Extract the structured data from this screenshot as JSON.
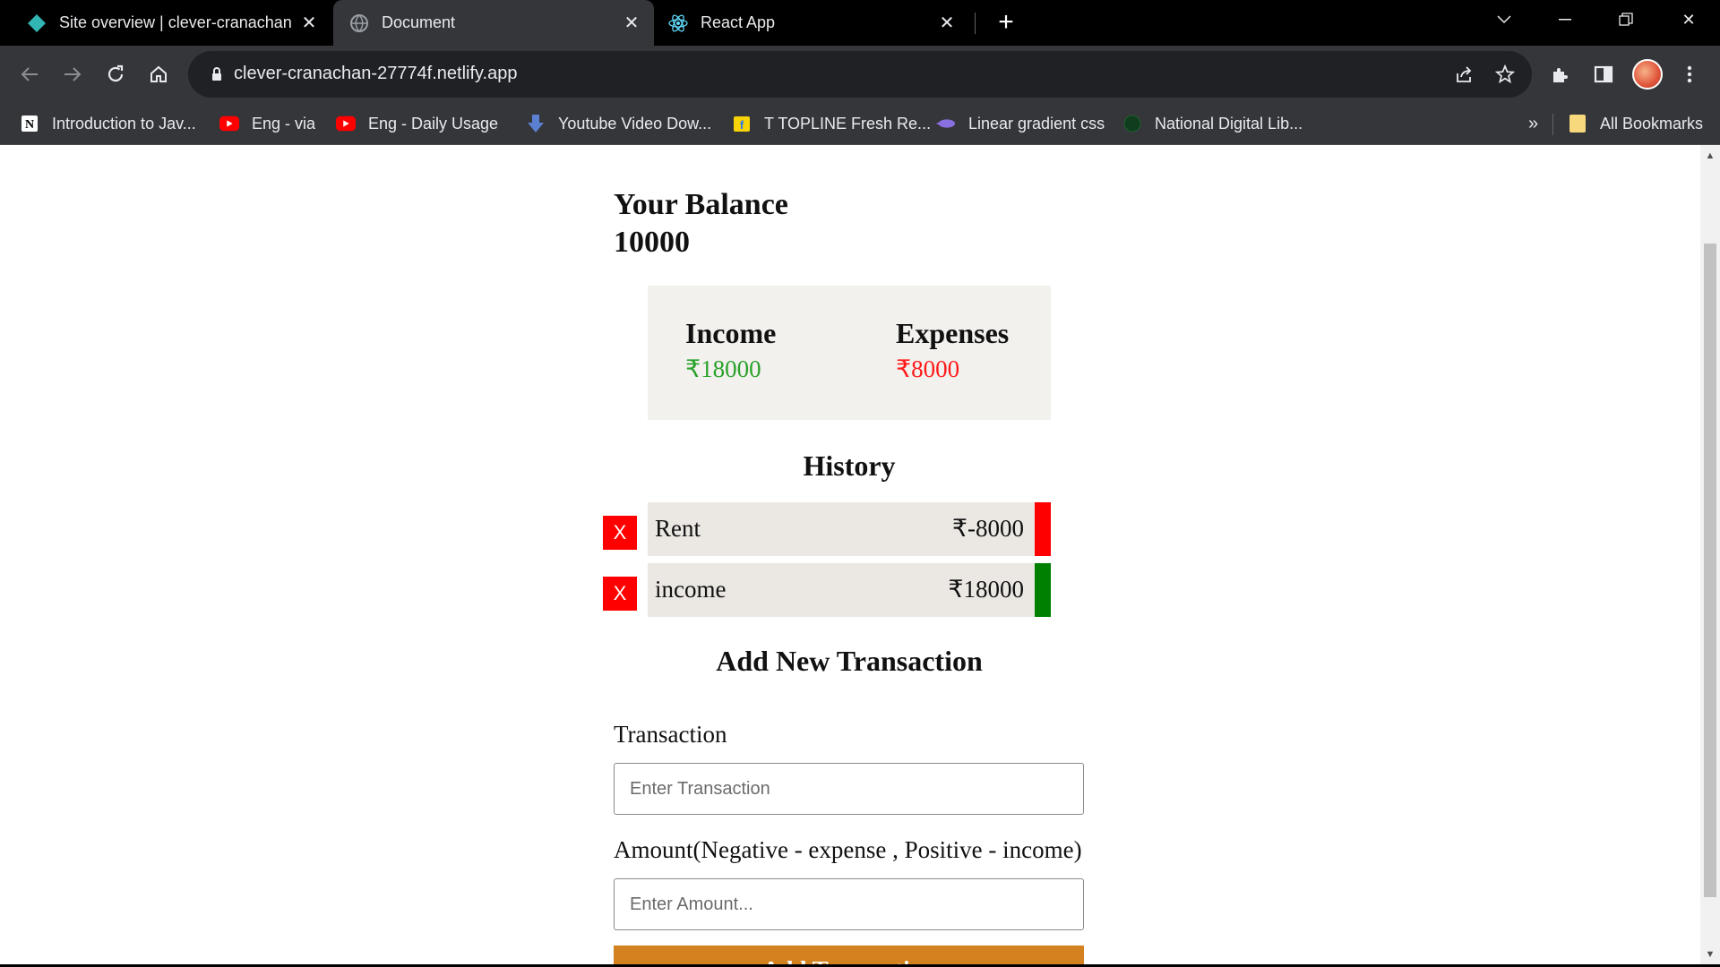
{
  "browser": {
    "tabs": [
      {
        "title": "Site overview | clever-cranachan",
        "active": false
      },
      {
        "title": "Document",
        "active": true
      },
      {
        "title": "React App",
        "active": false
      }
    ],
    "new_tab": "+",
    "url": "clever-cranachan-27774f.netlify.app",
    "bookmarks": [
      {
        "label": "Introduction to Jav...",
        "icon": "notion-icon"
      },
      {
        "label": "Eng - via",
        "icon": "youtube-icon"
      },
      {
        "label": "Eng -  Daily Usage",
        "icon": "youtube-icon"
      },
      {
        "label": "Youtube Video Dow...",
        "icon": "download-icon"
      },
      {
        "label": "T TOPLINE Fresh Re...",
        "icon": "flipkart-icon"
      },
      {
        "label": "Linear gradient css",
        "icon": "gradient-icon"
      },
      {
        "label": "National Digital Lib...",
        "icon": "globe-icon"
      }
    ],
    "bookmarks_overflow": "»",
    "all_bookmarks": "All Bookmarks"
  },
  "app": {
    "balance_label": "Your Balance",
    "balance_value": "10000",
    "income_label": "Income",
    "income_value": "₹18000",
    "expense_label": "Expenses",
    "expense_value": "₹8000",
    "history_title": "History",
    "history": [
      {
        "desc": "Rent",
        "amount": "₹-8000",
        "color": "#ff0000",
        "delete": "X"
      },
      {
        "desc": "income",
        "amount": "₹18000",
        "color": "#008000",
        "delete": "X"
      }
    ],
    "add_title": "Add New Transaction",
    "transaction_label": "Transaction",
    "transaction_placeholder": "Enter Transaction",
    "amount_label": "Amount(Negative - expense , Positive - income)",
    "amount_placeholder": "Enter Amount...",
    "add_button": "Add Transaction"
  },
  "colors": {
    "income": "#2aa12a",
    "expense": "#ff1a1a",
    "button": "#d4821f",
    "delete": "#ff0000"
  }
}
